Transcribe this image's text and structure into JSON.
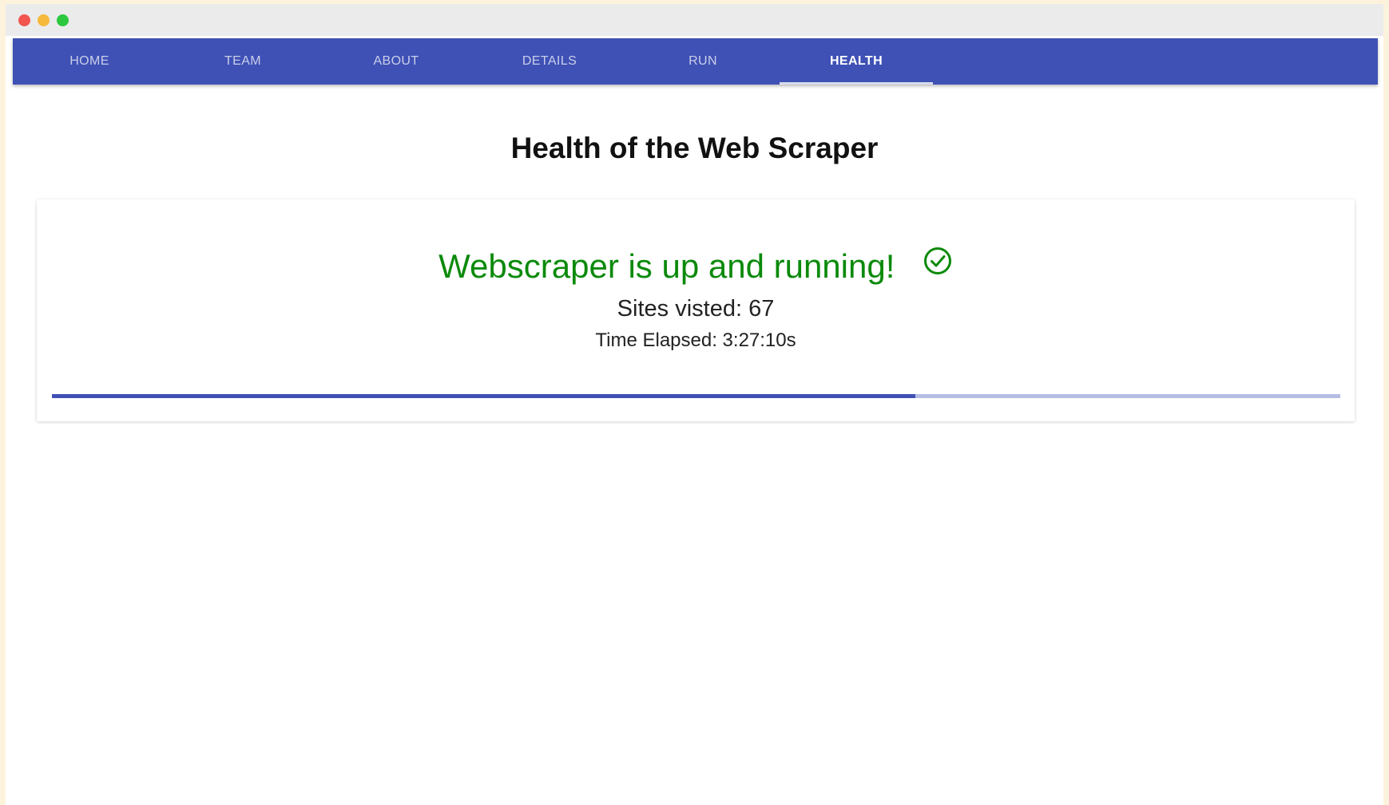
{
  "nav": {
    "tabs": [
      {
        "label": "HOME"
      },
      {
        "label": "TEAM"
      },
      {
        "label": "ABOUT"
      },
      {
        "label": "DETAILS"
      },
      {
        "label": "RUN"
      },
      {
        "label": "HEALTH",
        "active": true
      }
    ]
  },
  "page": {
    "title": "Health of the Web Scraper"
  },
  "status": {
    "message": "Webscraper is up and running!",
    "icon": "check-circle-icon",
    "sites_visited": "Sites visted: 67",
    "time_elapsed": "Time Elapsed: 3:27:10s",
    "progress_percent": 67
  },
  "colors": {
    "nav_background": "#3f51b5",
    "status_green": "#0b8a0b",
    "progress_fill": "#3f51b5",
    "progress_track": "#b6bde3"
  }
}
